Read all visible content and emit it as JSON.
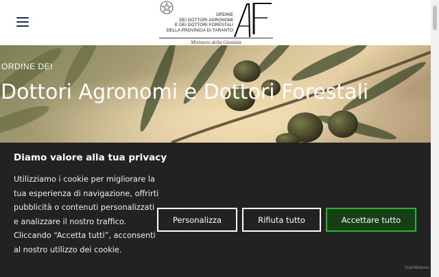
{
  "header": {
    "menu_icon": "hamburger-menu-icon",
    "logo": {
      "emblem_icon": "italian-republic-emblem-icon",
      "lines": [
        "ORDINE",
        "DEI DOTTORI AGRONOMI",
        "E DEI DOTTORI FORESTALI",
        "DELLA PROVINCIA DI TARANTO"
      ],
      "monogram": "AF",
      "subtitle": "Ministero della Giustizia"
    }
  },
  "hero": {
    "kicker": "ORDINE DEI",
    "title": "Dottori Agronomi e Dottori Forestali"
  },
  "cookie_banner": {
    "title": "Diamo valore alla tua privacy",
    "text": "Utilizziamo i cookie per migliorare la tua esperienza di navigazione, offrirti pubblicità o contenuti personalizzati e analizzare il nostro traffico. Cliccando “Accetta tutti”, acconsenti al nostro utilizzo dei cookie.",
    "buttons": {
      "personalize": "Personalizza",
      "reject": "Rifiuta tutto",
      "accept": "Accettare tutto"
    },
    "badge": "ScanMalware"
  },
  "colors": {
    "banner_bg": "#222222",
    "accept_border": "#2bb52b",
    "menu_icon": "#1a2f4a"
  }
}
